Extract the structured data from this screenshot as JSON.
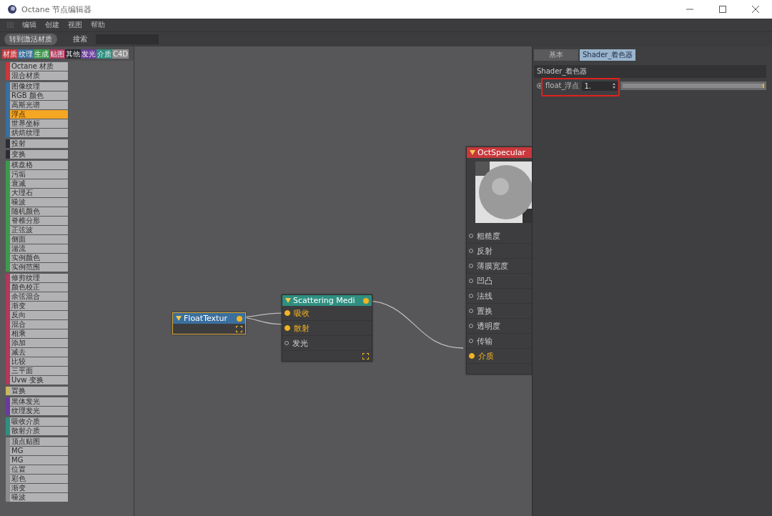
{
  "window": {
    "title": "Octane 节点编辑器"
  },
  "menu": [
    "编辑",
    "创建",
    "视图",
    "帮助"
  ],
  "toolbar": {
    "goto_button": "转到激活材质",
    "search_label": "搜索"
  },
  "categories": [
    {
      "label": "材质",
      "color": "#c8383c"
    },
    {
      "label": "纹理",
      "color": "#3a6f9e"
    },
    {
      "label": "生成",
      "color": "#3c9a4c"
    },
    {
      "label": "贴图",
      "color": "#b0385e"
    },
    {
      "label": "其他",
      "color": "#26282c"
    },
    {
      "label": "发光",
      "color": "#6a3a9e"
    },
    {
      "label": "介质",
      "color": "#2f8f80"
    },
    {
      "label": "C4D",
      "color": "#8c8c8c"
    }
  ],
  "node_groups": [
    {
      "color": "#c8383c",
      "items": [
        {
          "label": "Octane 材质",
          "selected": false
        },
        {
          "label": "混合材质",
          "selected": false
        }
      ]
    },
    {
      "color": "#3a6f9e",
      "items": [
        {
          "label": "图像纹理",
          "selected": false
        },
        {
          "label": "RGB 颜色",
          "selected": false
        },
        {
          "label": "高斯光谱",
          "selected": false
        },
        {
          "label": "浮点",
          "selected": true
        },
        {
          "label": "世界坐标",
          "selected": false
        },
        {
          "label": "烘焙纹理",
          "selected": false
        }
      ]
    },
    {
      "color": "#2a2d33",
      "items": [
        {
          "label": "投射",
          "selected": false
        }
      ]
    },
    {
      "color": "#2a2d33",
      "items": [
        {
          "label": "变换",
          "selected": false
        }
      ]
    },
    {
      "color": "#3c9a4c",
      "items": [
        {
          "label": "棋盘格",
          "selected": false
        },
        {
          "label": "污垢",
          "selected": false
        },
        {
          "label": "衰减",
          "selected": false
        },
        {
          "label": "大理石",
          "selected": false
        },
        {
          "label": "噪波",
          "selected": false
        },
        {
          "label": "随机颜色",
          "selected": false
        },
        {
          "label": "脊椎分形",
          "selected": false
        },
        {
          "label": "正弦波",
          "selected": false
        },
        {
          "label": "侧面",
          "selected": false
        },
        {
          "label": "湍流",
          "selected": false
        },
        {
          "label": "实例颜色",
          "selected": false
        },
        {
          "label": "实例范围",
          "selected": false
        }
      ]
    },
    {
      "color": "#b0385e",
      "items": [
        {
          "label": "修剪纹理",
          "selected": false
        },
        {
          "label": "颜色校正",
          "selected": false
        },
        {
          "label": "余弦混合",
          "selected": false
        },
        {
          "label": "渐变",
          "selected": false
        },
        {
          "label": "反向",
          "selected": false
        },
        {
          "label": "混合",
          "selected": false
        },
        {
          "label": "相乘",
          "selected": false
        },
        {
          "label": "添加",
          "selected": false
        },
        {
          "label": "减去",
          "selected": false
        },
        {
          "label": "比较",
          "selected": false
        },
        {
          "label": "三平面",
          "selected": false
        },
        {
          "label": "Uvw 变换",
          "selected": false
        }
      ]
    },
    {
      "color": "#c8b860",
      "items": [
        {
          "label": "置换",
          "selected": false
        }
      ]
    },
    {
      "color": "#6a3a9e",
      "items": [
        {
          "label": "黑体发光",
          "selected": false
        },
        {
          "label": "纹理发光",
          "selected": false
        }
      ]
    },
    {
      "color": "#2f8f80",
      "items": [
        {
          "label": "吸收介质",
          "selected": false
        },
        {
          "label": "散射介质",
          "selected": false
        }
      ]
    },
    {
      "color": "#8c8c8c",
      "items": [
        {
          "label": "顶点贴图",
          "selected": false
        },
        {
          "label": "MG",
          "selected": false
        },
        {
          "label": "MG",
          "selected": false
        },
        {
          "label": "位置",
          "selected": false
        },
        {
          "label": "彩色",
          "selected": false
        },
        {
          "label": "渐变",
          "selected": false
        },
        {
          "label": "噪波",
          "selected": false
        }
      ]
    }
  ],
  "nodes": [
    {
      "title": "FloatTextur",
      "color": "#3a6f9e",
      "selected": true,
      "preview": false
    },
    {
      "title": "Scattering Medi",
      "color": "#2f8f80",
      "selected": false,
      "preview": false,
      "inputs": [
        {
          "label": "吸收",
          "connected": true
        },
        {
          "label": "散射",
          "connected": true
        },
        {
          "label": "发光",
          "connected": false
        }
      ]
    },
    {
      "title": "OctSpecular",
      "color": "#c8383c",
      "selected": false,
      "preview": true,
      "inputs": [
        {
          "label": "粗糙度",
          "connected": false
        },
        {
          "label": "反射",
          "connected": false
        },
        {
          "label": "薄膜宽度",
          "connected": false
        },
        {
          "label": "凹凸",
          "connected": false
        },
        {
          "label": "法线",
          "connected": false
        },
        {
          "label": "置换",
          "connected": false
        },
        {
          "label": "透明度",
          "connected": false
        },
        {
          "label": "传输",
          "connected": false
        },
        {
          "label": "介质",
          "connected": true
        }
      ]
    }
  ],
  "attributes": {
    "tabs": [
      {
        "label": "基本",
        "selected": false
      },
      {
        "label": "Shader_着色器",
        "selected": true
      }
    ],
    "section": "Shader_着色器",
    "param": {
      "label": "float_浮点",
      "value": "1.",
      "level": 1.0
    }
  }
}
